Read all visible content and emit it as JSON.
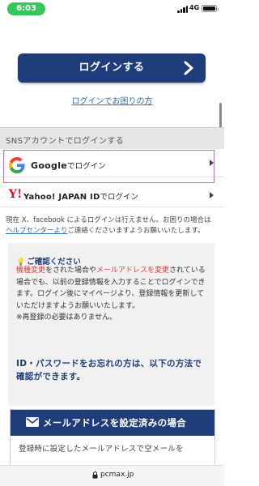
{
  "status_bar": {
    "time": "6:03",
    "network": "4G"
  },
  "login": {
    "button_label": "ログインする",
    "trouble_link": "ログインでお困りの方"
  },
  "sns": {
    "header": "SNSアカウントでログインする",
    "google": {
      "brand": "Google",
      "suffix": "でログイン"
    },
    "yahoo": {
      "logo": "Y!",
      "brand": "Yahoo! JAPAN ID",
      "suffix": "でログイン"
    }
  },
  "notice": {
    "part1": "現在 X、facebook によるログインは行えません。お困りの場合は",
    "link": "ヘルプセンターより",
    "part2": "ご連絡くださいますようお願いいたします。"
  },
  "confirm": {
    "title": "ご確認ください",
    "red1": "機種変更",
    "text1": "をされた場合や",
    "red2": "メールアドレスを変更",
    "text2": "されている場合でも、以前の登録情報を入力することでログインできます。ログイン後にマイページより、登録情報を更新していただけますようお願いいたします。",
    "note": "※再登録の必要はありません。",
    "forgot": "ID・パスワードをお忘れの方は、以下の方法で確認ができます。"
  },
  "email_section": {
    "header": "メールアドレスを設定済みの場合",
    "body": "登録時に設定したメールアドレスで空メールを"
  },
  "browser": {
    "url": "pcmax.jp"
  },
  "colors": {
    "navy": "#1f3d7a",
    "link": "#2a6fb0",
    "red": "#e23b3b",
    "highlight": "#e05bd8",
    "status_green": "#34c759"
  }
}
